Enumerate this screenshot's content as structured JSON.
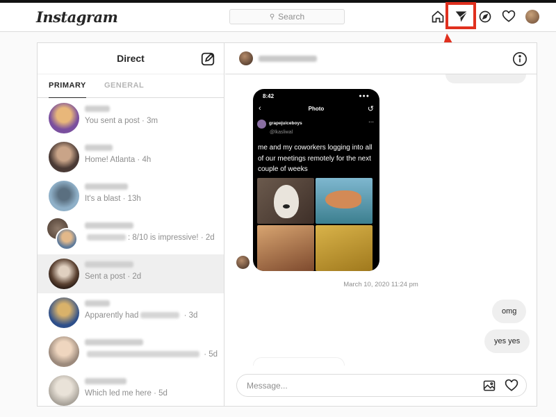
{
  "topbar": {
    "logo": "Instagram",
    "search_placeholder": "Search",
    "icons": [
      "home-icon",
      "direct-icon",
      "explore-icon",
      "heart-icon",
      "profile-avatar"
    ]
  },
  "direct": {
    "title": "Direct",
    "tabs": {
      "primary": "PRIMARY",
      "general": "GENERAL"
    },
    "conversations": [
      {
        "preview": "You sent a post · 3m"
      },
      {
        "preview": "Home! Atlanta · 4h"
      },
      {
        "preview": "It's a blast · 13h"
      },
      {
        "preview": ": 8/10 is impressive! · 2d"
      },
      {
        "preview": "Sent a post · 2d"
      },
      {
        "preview": "Apparently had",
        "preview_tail": " · 3d"
      },
      {
        "preview": " · 5d"
      },
      {
        "preview": "Which led me here · 5d"
      }
    ]
  },
  "chat": {
    "shared_post": {
      "time": "8:42",
      "screen_title": "Photo",
      "username": "grapejuiceboys",
      "handle": "@lkasliwal",
      "caption": "me and my coworkers logging into all of our meetings remotely for the next couple of weeks"
    },
    "timestamp": "March 10, 2020 11:24 pm",
    "messages": [
      "omg",
      "yes yes"
    ],
    "input_placeholder": "Message..."
  },
  "colors": {
    "highlight": "#e0301e"
  }
}
